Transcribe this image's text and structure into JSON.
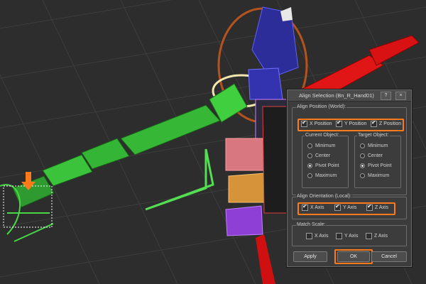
{
  "dialog": {
    "title": "Align Selection (Bn_R_Hand01)",
    "help_label": "?",
    "close_label": "×",
    "align_position": {
      "label": "Align Position (World):",
      "x": "X Position",
      "y": "Y Position",
      "z": "Z Position",
      "x_checked": true,
      "y_checked": true,
      "z_checked": true
    },
    "current_object": {
      "label": "Current Object:",
      "options": [
        "Minimum",
        "Center",
        "Pivot Point",
        "Maximum"
      ],
      "selected": "Pivot Point"
    },
    "target_object": {
      "label": "Target Object:",
      "options": [
        "Minimum",
        "Center",
        "Pivot Point",
        "Maximum"
      ],
      "selected": "Pivot Point"
    },
    "align_orientation": {
      "label": "Align Orientation (Local):",
      "x": "X Axis",
      "y": "Y Axis",
      "z": "Z Axis",
      "x_checked": true,
      "y_checked": true,
      "z_checked": true
    },
    "match_scale": {
      "label": "Match Scale:",
      "x": "X Axis",
      "y": "Y Axis",
      "z": "Z Axis",
      "x_checked": false,
      "y_checked": false,
      "z_checked": false
    },
    "buttons": {
      "apply": "Apply",
      "ok": "OK",
      "cancel": "Cancel"
    }
  },
  "colors": {
    "highlight": "#ff7a1a",
    "green_bones": "#3ecf3e",
    "red_bones": "#e01010",
    "blue_bones": "#2a2aa0",
    "selection": "#ffffff"
  }
}
